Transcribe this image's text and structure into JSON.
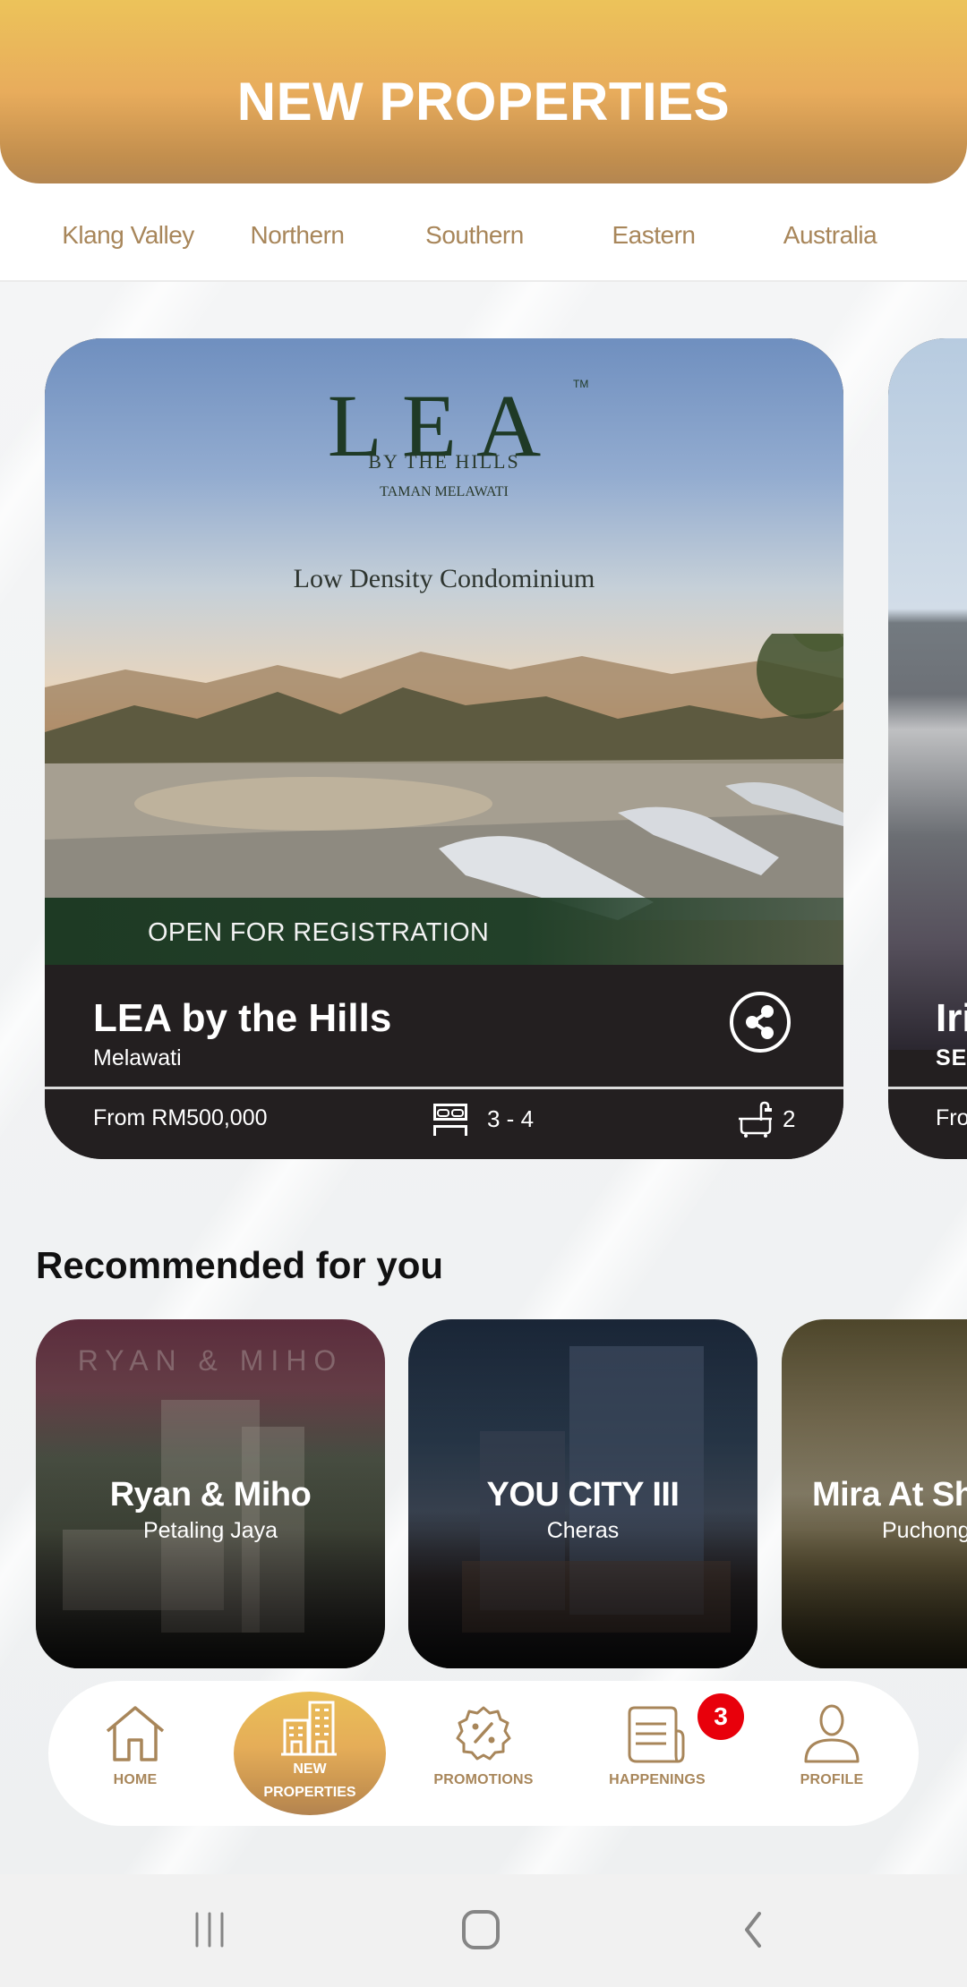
{
  "header": {
    "title": "NEW PROPERTIES"
  },
  "region_tabs": [
    {
      "label": "Klang Valley"
    },
    {
      "label": "Northern"
    },
    {
      "label": "Southern"
    },
    {
      "label": "Eastern"
    },
    {
      "label": "Australia"
    }
  ],
  "featured": [
    {
      "banner": {
        "logo": "LEA",
        "trademark": "TM",
        "logo_subtitle": "BY THE HILLS",
        "logo_location": "TAMAN MELAWATI",
        "tagline": "Low Density Condominium",
        "ribbon": "OPEN FOR REGISTRATION"
      },
      "name": "LEA by the Hills",
      "location": "Melawati",
      "price": "From RM500,000",
      "bedrooms": "3 - 4",
      "bathrooms": "2",
      "share_icon": "share-icon"
    },
    {
      "name": "Iri",
      "location": "SER",
      "price": "Fro"
    }
  ],
  "recommended": {
    "title": "Recommended for you",
    "items": [
      {
        "name": "Ryan & Miho",
        "location": "Petaling Jaya",
        "logo_text": "RYAN & MIHO"
      },
      {
        "name": "YOU CITY III",
        "location": "Cheras"
      },
      {
        "name": "Mira At Sh",
        "location": "Puchong"
      }
    ]
  },
  "bottom_nav": {
    "items": [
      {
        "label": "HOME",
        "icon": "home-icon"
      },
      {
        "label_line1": "NEW",
        "label_line2": "PROPERTIES",
        "icon": "buildings-icon",
        "active": true
      },
      {
        "label": "PROMOTIONS",
        "icon": "discount-badge-icon"
      },
      {
        "label": "HAPPENINGS",
        "icon": "newspaper-icon",
        "badge": "3"
      },
      {
        "label": "PROFILE",
        "icon": "user-icon"
      }
    ]
  },
  "colors": {
    "accent_gold": "#e8ac5c",
    "tab_text": "#a8865a",
    "card_dark": "#231f20",
    "badge_red": "#e8000b"
  }
}
